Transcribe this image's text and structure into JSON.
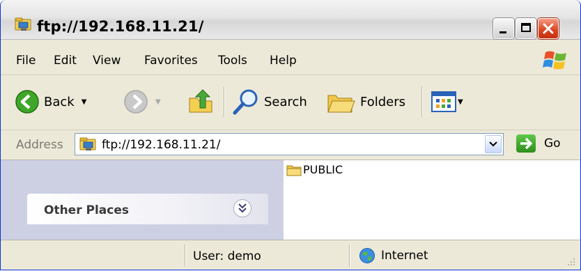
{
  "window": {
    "title": "ftp://192.168.11.21/",
    "icons": {
      "title": "ftp-folder-icon",
      "minimize": "minimize-icon",
      "maximize": "maximize-icon",
      "close": "close-icon"
    }
  },
  "menu": {
    "items": [
      "File",
      "Edit",
      "View",
      "Favorites",
      "Tools",
      "Help"
    ]
  },
  "toolbar": {
    "back_label": "Back",
    "search_label": "Search",
    "folders_label": "Folders",
    "dropdown_glyph": "▼"
  },
  "address": {
    "label": "Address",
    "value": "ftp://192.168.11.21/",
    "go_label": "Go"
  },
  "sidebar": {
    "other_places_title": "Other Places",
    "toggle_glyph": "»"
  },
  "files": {
    "items": [
      {
        "name": "PUBLIC",
        "icon": "folder-icon"
      }
    ]
  },
  "status": {
    "user": "User: demo",
    "zone": "Internet"
  },
  "colors": {
    "title_bar": "#e0e0e0",
    "chrome": "#ece9d8",
    "sidebar_panel": "#cdd0e3",
    "close_button": "#d9431e",
    "go_green": "#3fa62a",
    "folder_yellow": "#f4cf52"
  }
}
